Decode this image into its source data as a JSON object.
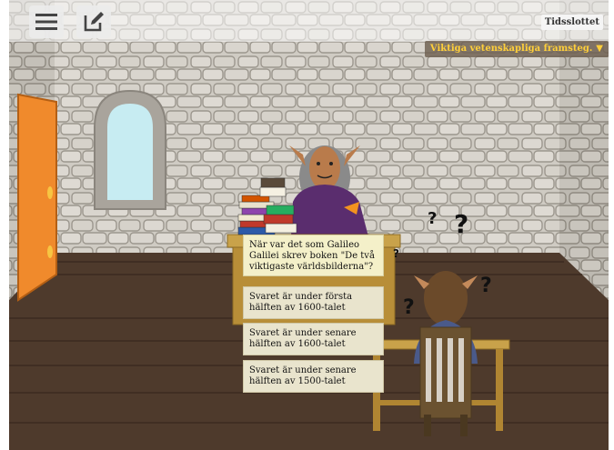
{
  "toolbar": {
    "menu_icon": "hamburger-menu-icon",
    "notes_icon": "edit-note-icon"
  },
  "location": {
    "label": "Tidsslottet"
  },
  "goal": {
    "text": "Viktiga vetenskapliga framsteg.",
    "arrow": "▼",
    "color": "#ffcf3a"
  },
  "question": {
    "text": "När var det som Galileo Galilei skrev boken \"De två viktigaste världsbilderna\"?"
  },
  "answers": [
    {
      "text": "Svaret är under första hälften av 1600-talet"
    },
    {
      "text": "Svaret är under senare hälften av 1600-talet"
    },
    {
      "text": "Svaret är under senare hälften av 1500-talet"
    }
  ],
  "thought_marks": [
    "?",
    "?",
    "?",
    "?",
    "?"
  ],
  "colors": {
    "wall": "#cfcbc3",
    "floor": "#4e3a2c",
    "door": "#f08a2c",
    "robe": "#5a2d6e"
  }
}
